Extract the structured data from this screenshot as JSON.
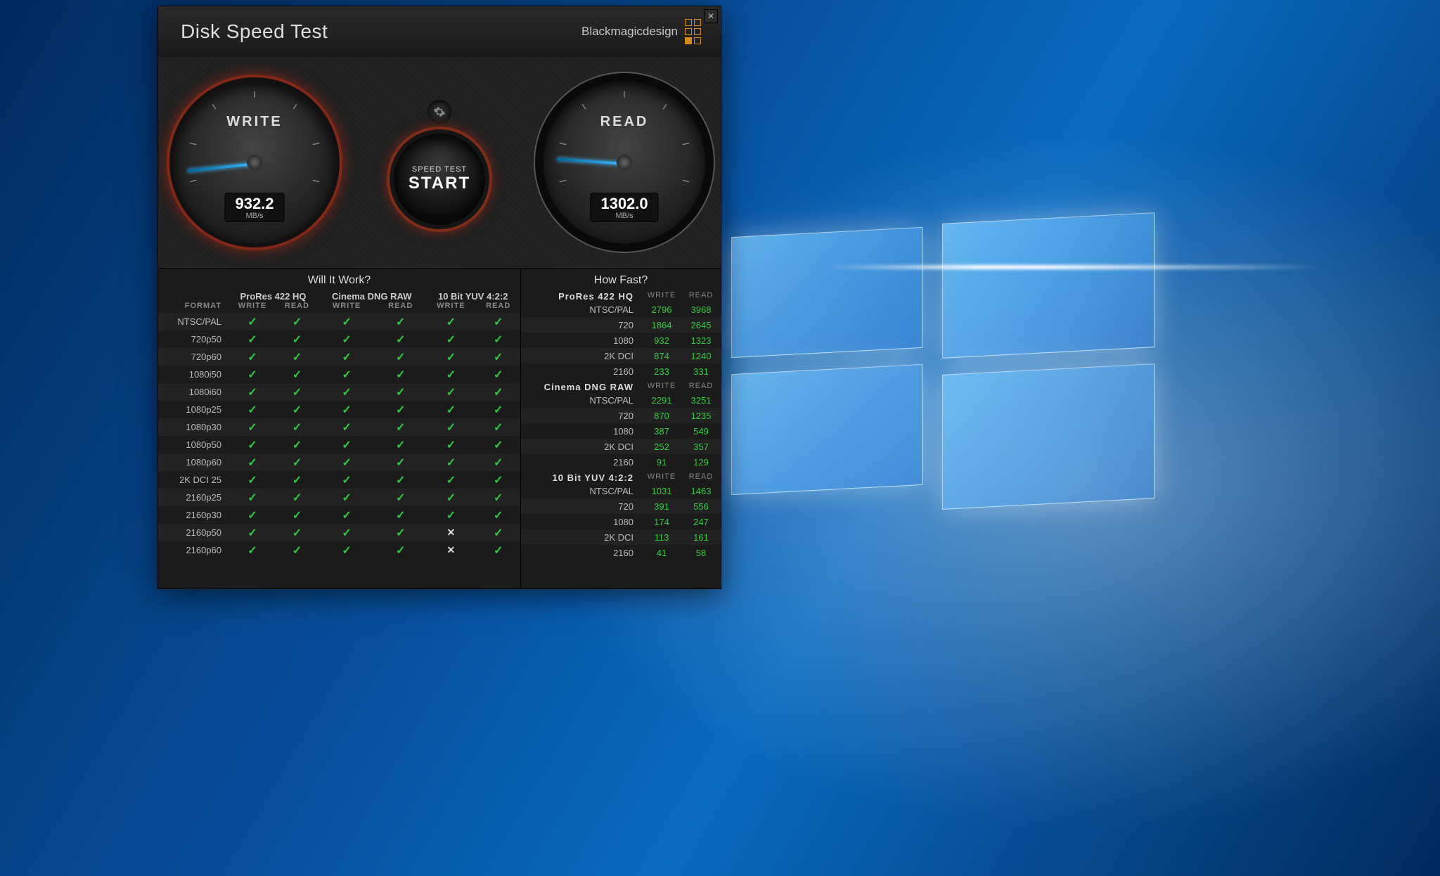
{
  "desktop": {
    "os": "Windows 10"
  },
  "header": {
    "title": "Disk Speed Test",
    "brand": "Blackmagicdesign"
  },
  "gauges": {
    "write": {
      "label": "WRITE",
      "value": "932.2",
      "unit": "MB/s",
      "needle_deg": -186
    },
    "read": {
      "label": "READ",
      "value": "1302.0",
      "unit": "MB/s",
      "needle_deg": -176
    },
    "settings_icon": "gear-icon",
    "start": {
      "line1": "SPEED TEST",
      "line2": "START"
    }
  },
  "will_it_work": {
    "title": "Will It Work?",
    "format_header": "FORMAT",
    "codecs": [
      "ProRes 422 HQ",
      "Cinema DNG RAW",
      "10 Bit YUV 4:2:2"
    ],
    "subcols": [
      "WRITE",
      "READ"
    ],
    "rows": [
      {
        "label": "NTSC/PAL",
        "cells": [
          "y",
          "y",
          "y",
          "y",
          "y",
          "y"
        ]
      },
      {
        "label": "720p50",
        "cells": [
          "y",
          "y",
          "y",
          "y",
          "y",
          "y"
        ]
      },
      {
        "label": "720p60",
        "cells": [
          "y",
          "y",
          "y",
          "y",
          "y",
          "y"
        ]
      },
      {
        "label": "1080i50",
        "cells": [
          "y",
          "y",
          "y",
          "y",
          "y",
          "y"
        ]
      },
      {
        "label": "1080i60",
        "cells": [
          "y",
          "y",
          "y",
          "y",
          "y",
          "y"
        ]
      },
      {
        "label": "1080p25",
        "cells": [
          "y",
          "y",
          "y",
          "y",
          "y",
          "y"
        ]
      },
      {
        "label": "1080p30",
        "cells": [
          "y",
          "y",
          "y",
          "y",
          "y",
          "y"
        ]
      },
      {
        "label": "1080p50",
        "cells": [
          "y",
          "y",
          "y",
          "y",
          "y",
          "y"
        ]
      },
      {
        "label": "1080p60",
        "cells": [
          "y",
          "y",
          "y",
          "y",
          "y",
          "y"
        ]
      },
      {
        "label": "2K DCI 25",
        "cells": [
          "y",
          "y",
          "y",
          "y",
          "y",
          "y"
        ]
      },
      {
        "label": "2160p25",
        "cells": [
          "y",
          "y",
          "y",
          "y",
          "y",
          "y"
        ]
      },
      {
        "label": "2160p30",
        "cells": [
          "y",
          "y",
          "y",
          "y",
          "y",
          "y"
        ]
      },
      {
        "label": "2160p50",
        "cells": [
          "y",
          "y",
          "y",
          "y",
          "n",
          "y"
        ]
      },
      {
        "label": "2160p60",
        "cells": [
          "y",
          "y",
          "y",
          "y",
          "n",
          "y"
        ]
      }
    ]
  },
  "how_fast": {
    "title": "How Fast?",
    "subcols": [
      "WRITE",
      "READ"
    ],
    "groups": [
      {
        "name": "ProRes 422 HQ",
        "rows": [
          {
            "label": "NTSC/PAL",
            "write": "2796",
            "read": "3968"
          },
          {
            "label": "720",
            "write": "1864",
            "read": "2645"
          },
          {
            "label": "1080",
            "write": "932",
            "read": "1323"
          },
          {
            "label": "2K DCI",
            "write": "874",
            "read": "1240"
          },
          {
            "label": "2160",
            "write": "233",
            "read": "331"
          }
        ]
      },
      {
        "name": "Cinema DNG RAW",
        "rows": [
          {
            "label": "NTSC/PAL",
            "write": "2291",
            "read": "3251"
          },
          {
            "label": "720",
            "write": "870",
            "read": "1235"
          },
          {
            "label": "1080",
            "write": "387",
            "read": "549"
          },
          {
            "label": "2K DCI",
            "write": "252",
            "read": "357"
          },
          {
            "label": "2160",
            "write": "91",
            "read": "129"
          }
        ]
      },
      {
        "name": "10 Bit YUV 4:2:2",
        "rows": [
          {
            "label": "NTSC/PAL",
            "write": "1031",
            "read": "1463"
          },
          {
            "label": "720",
            "write": "391",
            "read": "556"
          },
          {
            "label": "1080",
            "write": "174",
            "read": "247"
          },
          {
            "label": "2K DCI",
            "write": "113",
            "read": "161"
          },
          {
            "label": "2160",
            "write": "41",
            "read": "58"
          }
        ]
      }
    ]
  }
}
